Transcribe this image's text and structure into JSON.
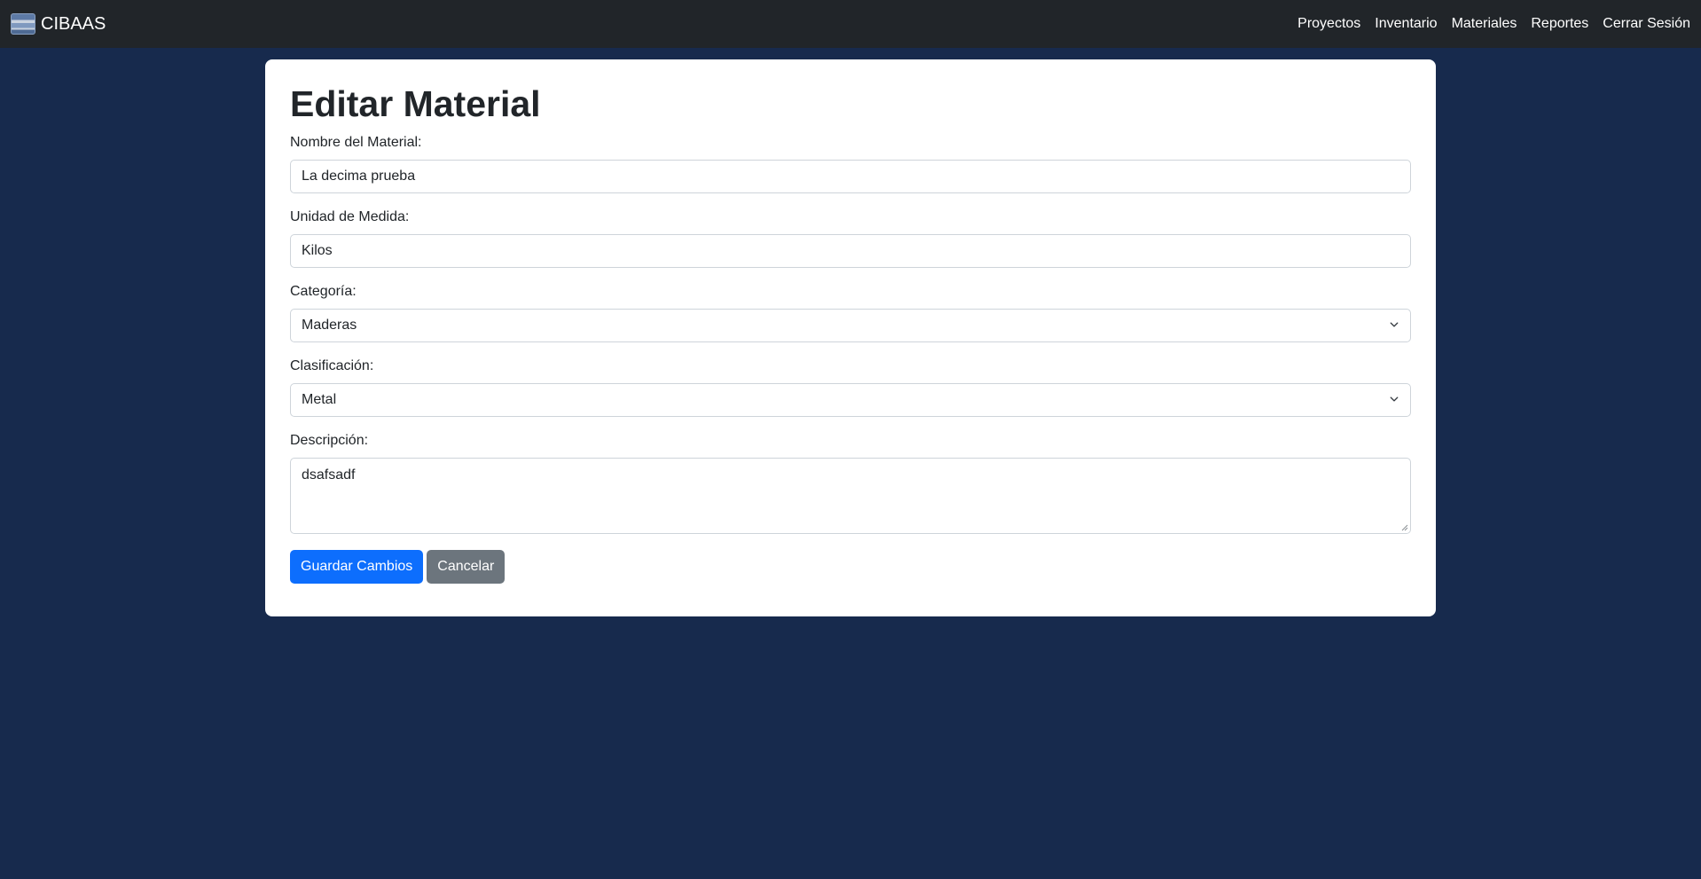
{
  "navbar": {
    "brand": "CIBAAS",
    "links": [
      {
        "label": "Proyectos"
      },
      {
        "label": "Inventario"
      },
      {
        "label": "Materiales"
      },
      {
        "label": "Reportes"
      },
      {
        "label": "Cerrar Sesión"
      }
    ]
  },
  "form": {
    "title": "Editar Material",
    "nombre": {
      "label": "Nombre del Material:",
      "value": "La decima prueba"
    },
    "unidad": {
      "label": "Unidad de Medida:",
      "value": "Kilos"
    },
    "categoria": {
      "label": "Categoría:",
      "value": "Maderas"
    },
    "clasificacion": {
      "label": "Clasificación:",
      "value": "Metal"
    },
    "descripcion": {
      "label": "Descripción:",
      "value": "dsafsadf"
    },
    "save_label": "Guardar Cambios",
    "cancel_label": "Cancelar"
  },
  "colors": {
    "background": "#172a4d",
    "navbar": "#212529",
    "primary": "#0d6efd",
    "secondary": "#6c757d"
  }
}
